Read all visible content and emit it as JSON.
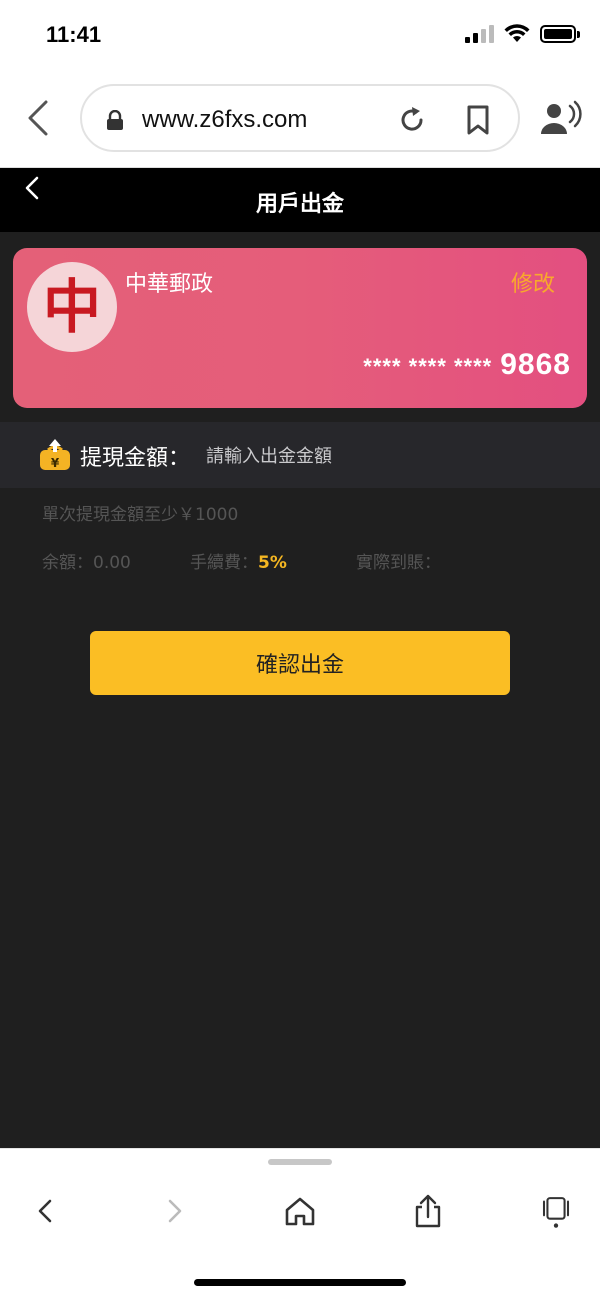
{
  "status_bar": {
    "time": "11:41"
  },
  "browser": {
    "url": "www.z6fxs.com"
  },
  "header": {
    "title": "用戶出金"
  },
  "card": {
    "logo_glyph": "中",
    "bank_name": "中華郵政",
    "edit_label": "修改",
    "masked_number": "**** **** ****",
    "last_four": "9868",
    "colors": {
      "gradient_start": "#e46078",
      "gradient_end": "#e34f80",
      "edit": "#f8a92c"
    }
  },
  "withdraw": {
    "label": "提現金額：",
    "placeholder": "請輸入出金金額",
    "value": ""
  },
  "info": {
    "min_note": "單次提現金額至少￥1000",
    "balance": "余額：0.00",
    "fee_label": "手續費：",
    "fee_value": "5%",
    "actual_label": "實際到賬："
  },
  "confirm": {
    "label": "確認出金",
    "color": "#fbbe24"
  },
  "toolbar": {
    "icons": [
      "back-icon",
      "forward-icon",
      "home-icon",
      "share-icon",
      "tabs-icon"
    ]
  }
}
